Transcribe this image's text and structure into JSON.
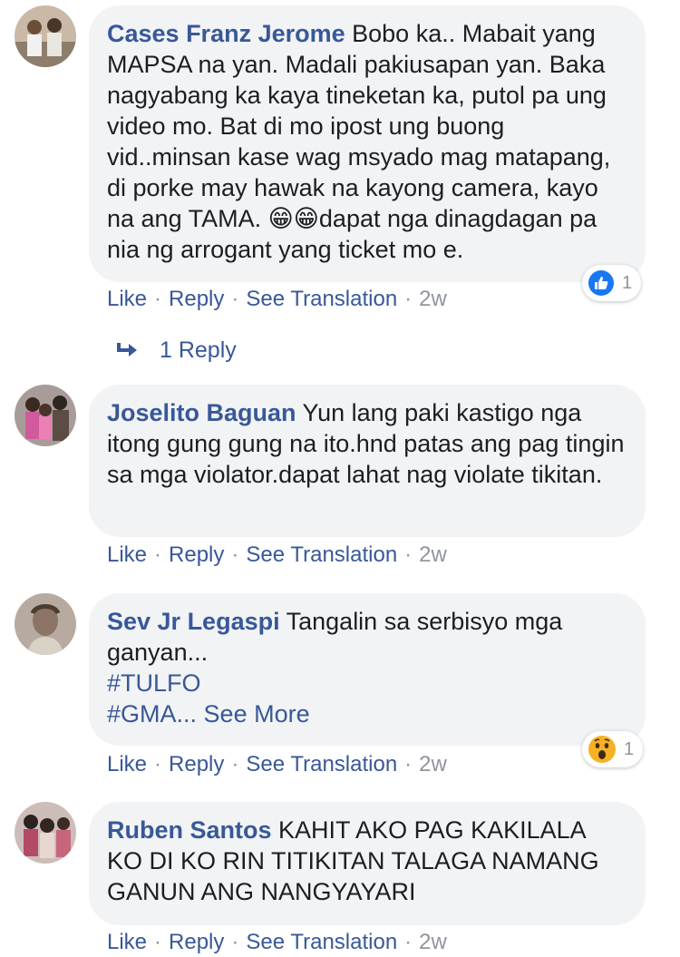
{
  "comments": [
    {
      "author": "Cases Franz Jerome",
      "text": " Bobo ka.. Mabait yang MAPSA na yan. Madali pakiusapan yan. Baka nagyabang ka kaya tineketan ka, putol pa ung video mo. Bat di mo ipost ung buong vid..minsan kase wag msyado mag matapang, di porke may hawak na kayong camera, kayo na ang TAMA. ",
      "text_after_emoji": "dapat nga dinagdagan pa nia ng arrogant yang ticket mo e.",
      "emoji": "😁😁",
      "actions": {
        "like": "Like",
        "reply": "Reply",
        "translate": "See Translation",
        "time": "2w"
      },
      "reaction": {
        "icon": "like-icon",
        "count": "1",
        "color": "#1877f2"
      },
      "replies_label": "1 Reply"
    },
    {
      "author": "Joselito Baguan",
      "text": " Yun lang paki kastigo nga itong gung gung na ito.hnd patas ang pag tingin sa mga violator.dapat lahat nag violate tikitan.",
      "actions": {
        "like": "Like",
        "reply": "Reply",
        "translate": "See Translation",
        "time": "2w"
      }
    },
    {
      "author": "Sev Jr Legaspi",
      "text": " Tangalin sa serbisyo mga ganyan...",
      "hashtag1": "#TULFO",
      "hashtag2": "#GMA...",
      "see_more": "See More",
      "actions": {
        "like": "Like",
        "reply": "Reply",
        "translate": "See Translation",
        "time": "2w"
      },
      "reaction": {
        "icon": "wow-icon",
        "count": "1",
        "color": "#f7b125"
      }
    },
    {
      "author": "Ruben Santos",
      "text": " KAHIT AKO PAG KAKILALA KO DI KO RIN TITIKITAN TALAGA NAMANG GANUN ANG NANGYAYARI",
      "actions": {
        "like": "Like",
        "reply": "Reply",
        "translate": "See Translation",
        "time": "2w"
      }
    }
  ],
  "colors": {
    "link": "#385898",
    "bubble": "#f2f3f5",
    "meta": "#90949c"
  }
}
